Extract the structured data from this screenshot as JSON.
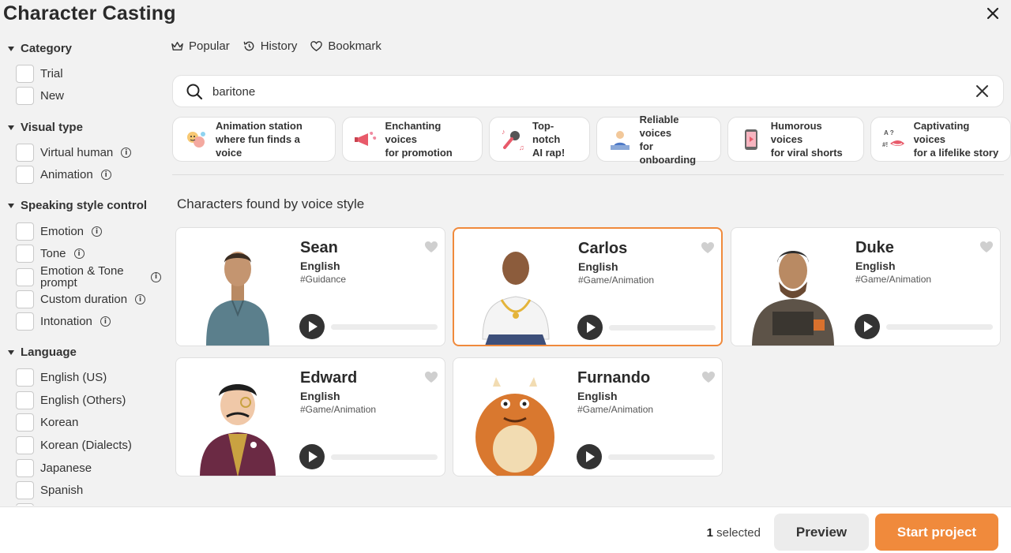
{
  "title": "Character Casting",
  "sidebar": {
    "category": {
      "label": "Category",
      "items": [
        "Trial",
        "New"
      ]
    },
    "visual_type": {
      "label": "Visual type",
      "items": [
        "Virtual human",
        "Animation"
      ]
    },
    "speaking_style": {
      "label": "Speaking style control",
      "items": [
        "Emotion",
        "Tone",
        "Emotion & Tone prompt",
        "Custom duration",
        "Intonation"
      ]
    },
    "language": {
      "label": "Language",
      "items": [
        "English (US)",
        "English (Others)",
        "Korean",
        "Korean (Dialects)",
        "Japanese",
        "Spanish"
      ]
    }
  },
  "tabs": [
    "Popular",
    "History",
    "Bookmark"
  ],
  "search": {
    "value": "baritone"
  },
  "chips": [
    {
      "line1": "Animation station",
      "line2": "where fun finds a voice",
      "icon": "animation-icon"
    },
    {
      "line1": "Enchanting voices",
      "line2": "for promotion",
      "icon": "megaphone-icon"
    },
    {
      "line1": "Top-notch",
      "line2": "AI rap!",
      "icon": "microphone-icon"
    },
    {
      "line1": "Reliable voices",
      "line2": "for onboarding",
      "icon": "presenter-icon"
    },
    {
      "line1": "Humorous voices",
      "line2": "for viral shorts",
      "icon": "phone-video-icon"
    },
    {
      "line1": "Captivating voices",
      "line2": "for a lifelike story",
      "icon": "storyteller-icon"
    }
  ],
  "section_heading": "Characters found by voice style",
  "characters": [
    {
      "name": "Sean",
      "language": "English",
      "tag": "#Guidance",
      "selected": false
    },
    {
      "name": "Carlos",
      "language": "English",
      "tag": "#Game/Animation",
      "selected": true
    },
    {
      "name": "Duke",
      "language": "English",
      "tag": "#Game/Animation",
      "selected": false
    },
    {
      "name": "Edward",
      "language": "English",
      "tag": "#Game/Animation",
      "selected": false
    },
    {
      "name": "Furnando",
      "language": "English",
      "tag": "#Game/Animation",
      "selected": false
    }
  ],
  "footer": {
    "selected_count": "1",
    "selected_label": " selected",
    "preview_label": "Preview",
    "start_label": "Start project"
  },
  "colors": {
    "accent": "#f08a3c",
    "background": "#f2f2f2"
  }
}
